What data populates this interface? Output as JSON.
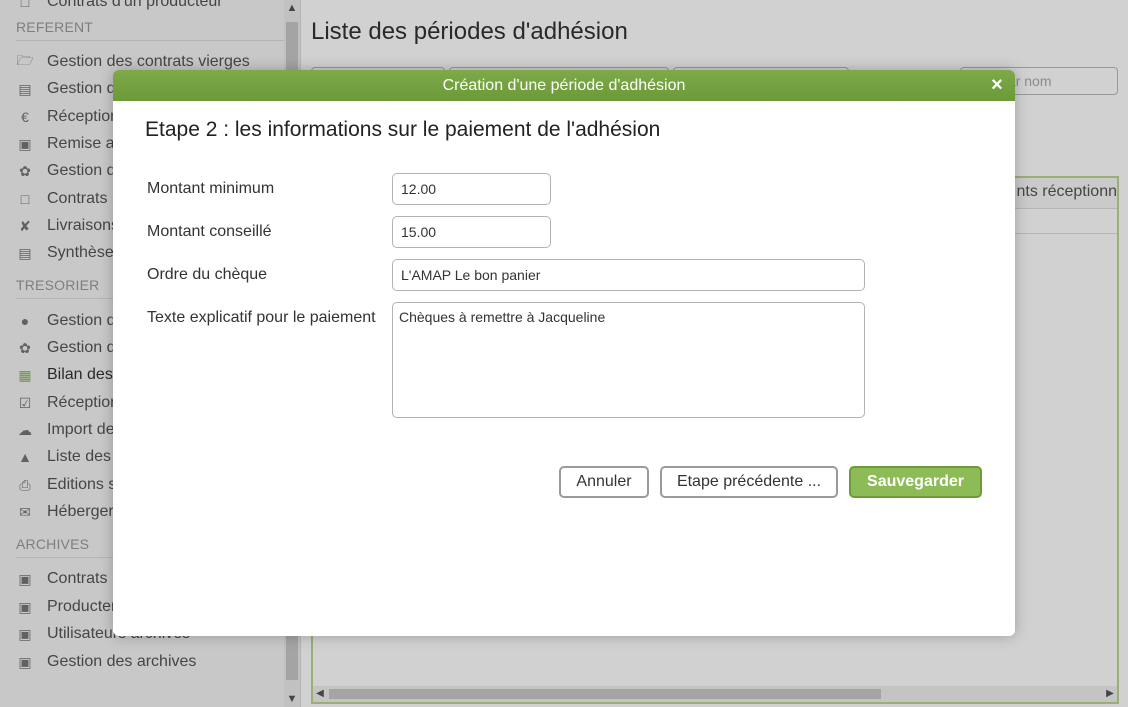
{
  "sidebar": {
    "top_item": "Contrats d'un producteur",
    "sections": {
      "referent": "REFERENT",
      "tresorier": "TRESORIER",
      "archives": "ARCHIVES"
    },
    "referent_items": [
      {
        "label": "Gestion des contrats vierges",
        "icon": "folder-open-icon"
      },
      {
        "label": "Gestion d",
        "icon": "file-text-icon"
      },
      {
        "label": "Réception",
        "icon": "euro-icon"
      },
      {
        "label": "Remise a",
        "icon": "money-icon"
      },
      {
        "label": "Gestion d",
        "icon": "leaf-icon"
      },
      {
        "label": "Contrats",
        "icon": "file-icon"
      },
      {
        "label": "Livraisons",
        "icon": "cutlery-icon"
      },
      {
        "label": "Synthèse",
        "icon": "bar-chart-icon"
      }
    ],
    "tresorier_items": [
      {
        "label": "Gestion d",
        "icon": "users-icon"
      },
      {
        "label": "Gestion d",
        "icon": "leaf-icon"
      },
      {
        "label": "Bilan des",
        "icon": "table-icon",
        "active": true
      },
      {
        "label": "Réception",
        "icon": "check-square-icon"
      },
      {
        "label": "Import de",
        "icon": "cloud-download-icon"
      },
      {
        "label": "Liste des",
        "icon": "graduation-cap-icon"
      },
      {
        "label": "Editions s",
        "icon": "print-icon"
      },
      {
        "label": "Héberger",
        "icon": "envelope-icon"
      }
    ],
    "archives_items": [
      {
        "label": "Contrats",
        "icon": "archive-icon"
      },
      {
        "label": "Producter",
        "icon": "archive-icon"
      },
      {
        "label": "Utilisateurs archivés",
        "icon": "archive-icon"
      },
      {
        "label": "Gestion des archives",
        "icon": "archive-icon"
      }
    ]
  },
  "main": {
    "title": "Liste des périodes d'adhésion",
    "search_placeholder": "cher par nom",
    "grid_header_partial": "nts réceptionn"
  },
  "modal": {
    "header": "Création d'une période d'adhésion",
    "close_glyph": "×",
    "step_title": "Etape 2 : les informations sur le paiement de l'adhésion",
    "fields": {
      "min_amount": {
        "label": "Montant minimum",
        "value": "12.00"
      },
      "advised_amount": {
        "label": "Montant conseillé",
        "value": "15.00"
      },
      "check_order": {
        "label": "Ordre du chèque",
        "value": "L'AMAP Le bon panier"
      },
      "payment_text": {
        "label": "Texte explicatif pour le paiement",
        "value": "Chèques à remettre à Jacqueline"
      }
    },
    "buttons": {
      "cancel": "Annuler",
      "previous": "Etape précédente ...",
      "save": "Sauvegarder"
    }
  },
  "colors": {
    "accent_green": "#7fa94a",
    "save_button": "#8dbc57"
  }
}
